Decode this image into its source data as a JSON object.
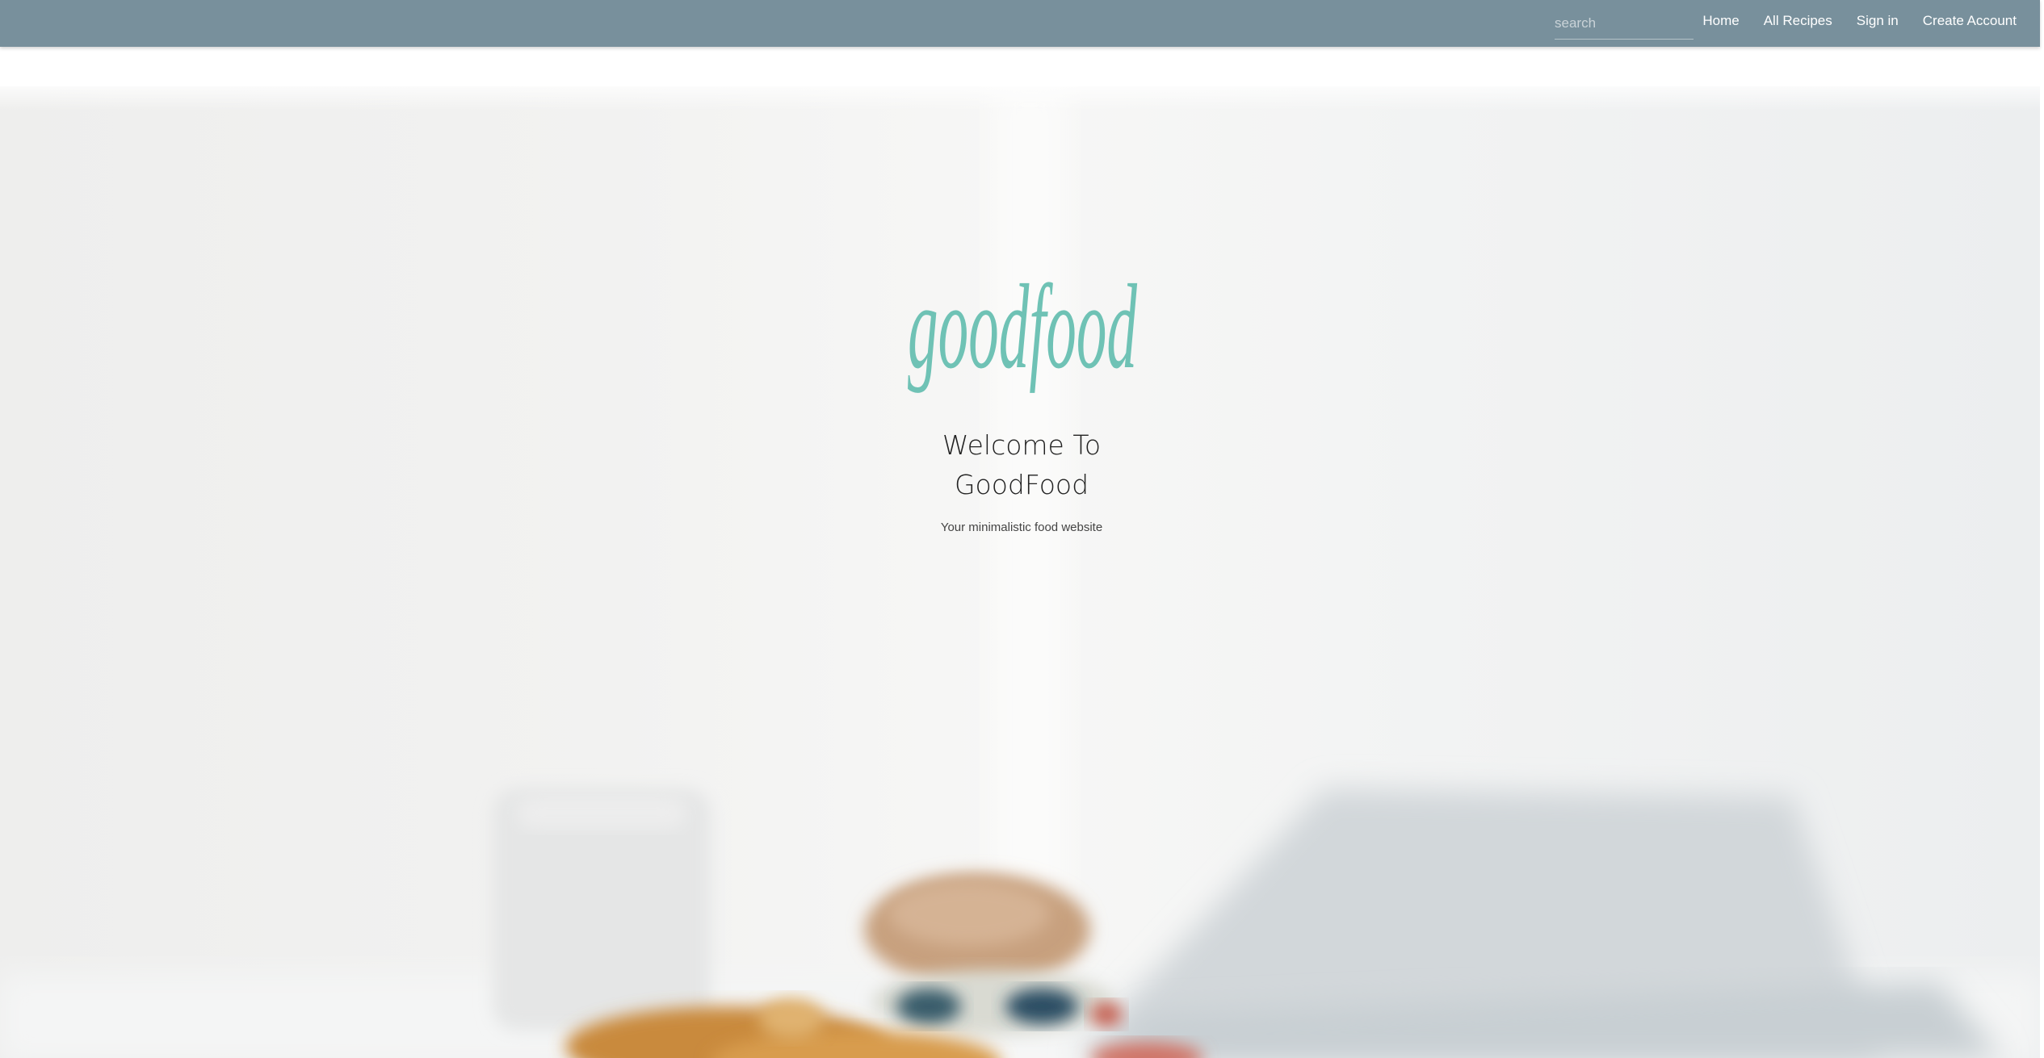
{
  "nav": {
    "search_placeholder": "search",
    "links": [
      "Home",
      "All Recipes",
      "Sign in",
      "Create Account"
    ]
  },
  "hero": {
    "logo_text": "goodfood",
    "title_line1": "Welcome To",
    "title_line2": "GoodFood",
    "subtitle": "Your minimalistic food website"
  },
  "colors": {
    "navbar": "#78909c",
    "logo": "#6fc2b5"
  },
  "icons": [
    "goodfood-logo"
  ]
}
